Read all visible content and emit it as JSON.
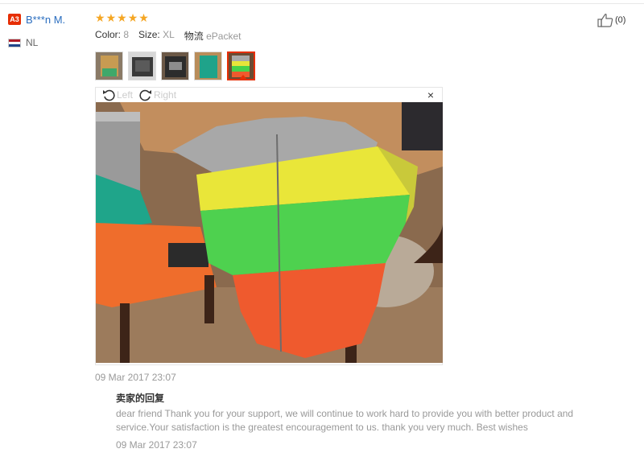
{
  "buyer": {
    "level_badge": "A3",
    "name": "B***n M.",
    "country": "NL",
    "flag_colors": [
      "#ae1c28",
      "#ffffff",
      "#21468b"
    ]
  },
  "review": {
    "rating": 5,
    "star_glyph": "★",
    "star_color": "#f5a623",
    "attributes": [
      {
        "label": "Color:",
        "value": "8"
      },
      {
        "label": "Size:",
        "value": "XL"
      },
      {
        "label": "物流",
        "value": "ePacket"
      }
    ],
    "helpful_count": "(0)",
    "thumbnails": [
      "photo-1",
      "photo-2",
      "photo-3",
      "photo-4",
      "photo-5"
    ],
    "active_thumbnail": 4,
    "viewer": {
      "rotate_left": "Left",
      "rotate_right": "Right",
      "close": "×"
    },
    "date": "09 Mar 2017 23:07"
  },
  "seller_reply": {
    "title": "卖家的回复",
    "text": "dear friend Thank you for your support, we will continue to work hard to provide you with better product and service.Your satisfaction is the greatest encouragement to us. thank you very much. Best wishes",
    "date": "09 Mar 2017 23:07"
  },
  "colors": {
    "accent": "#e62e04",
    "link": "#2a6dbf",
    "muted": "#999999"
  }
}
